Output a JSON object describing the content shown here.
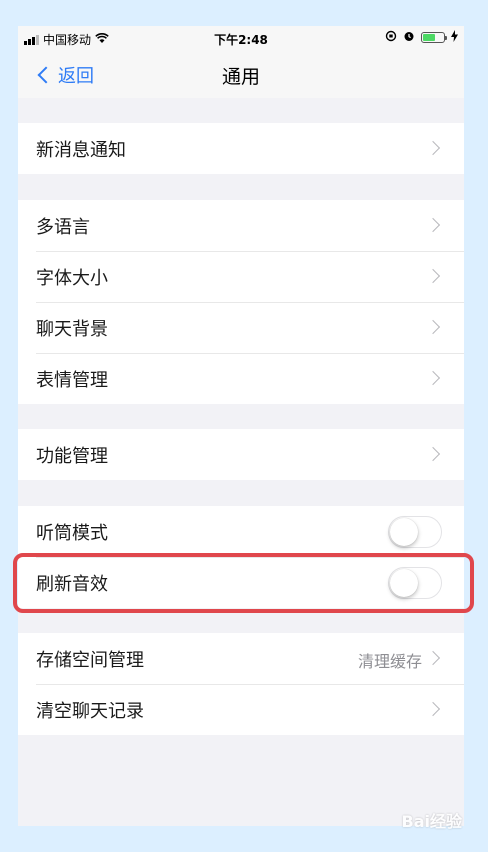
{
  "status_bar": {
    "carrier": "中国移动",
    "time": "下午2:48"
  },
  "nav": {
    "back_label": "返回",
    "title": "通用"
  },
  "sections": [
    {
      "rows": [
        {
          "label": "新消息通知"
        }
      ]
    },
    {
      "rows": [
        {
          "label": "多语言"
        },
        {
          "label": "字体大小"
        },
        {
          "label": "聊天背景"
        },
        {
          "label": "表情管理"
        }
      ]
    },
    {
      "rows": [
        {
          "label": "功能管理"
        }
      ]
    },
    {
      "rows": [
        {
          "label": "听筒模式",
          "toggle_on": false
        },
        {
          "label": "刷新音效",
          "toggle_on": false
        }
      ]
    },
    {
      "rows": [
        {
          "label": "存储空间管理",
          "value": "清理缓存"
        },
        {
          "label": "清空聊天记录"
        }
      ]
    }
  ],
  "watermark": "Bai经验",
  "colors": {
    "accent": "#2f7cf6",
    "highlight": "#e0474c",
    "battery": "#4cd964"
  }
}
